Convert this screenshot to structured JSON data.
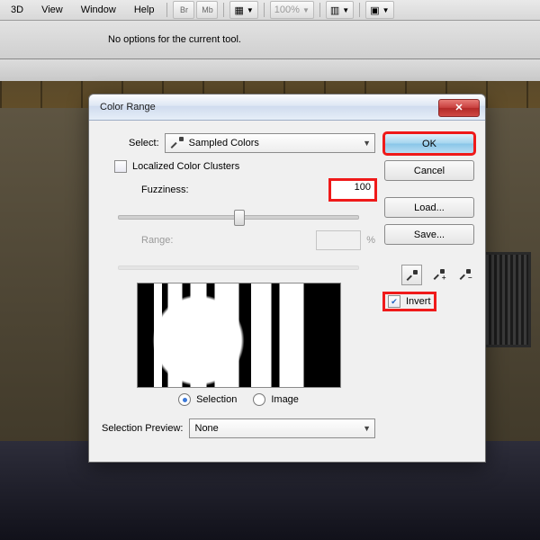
{
  "menubar": {
    "items": [
      "3D",
      "View",
      "Window",
      "Help"
    ],
    "zoom": "100%",
    "br": "Br",
    "mb": "Mb"
  },
  "optbar": {
    "msg": "No options for the current tool."
  },
  "dialog": {
    "title": "Color Range",
    "select_label": "Select:",
    "select_value": "Sampled Colors",
    "localized_label": "Localized Color Clusters",
    "localized_checked": false,
    "fuzziness_label": "Fuzziness:",
    "fuzziness_value": "100",
    "range_label": "Range:",
    "range_value": "",
    "range_suffix": "%",
    "radio_selection": "Selection",
    "radio_image": "Image",
    "preview_label": "Selection Preview:",
    "preview_value": "None",
    "buttons": {
      "ok": "OK",
      "cancel": "Cancel",
      "load": "Load...",
      "save": "Save..."
    },
    "invert_label": "Invert",
    "invert_checked": true
  }
}
